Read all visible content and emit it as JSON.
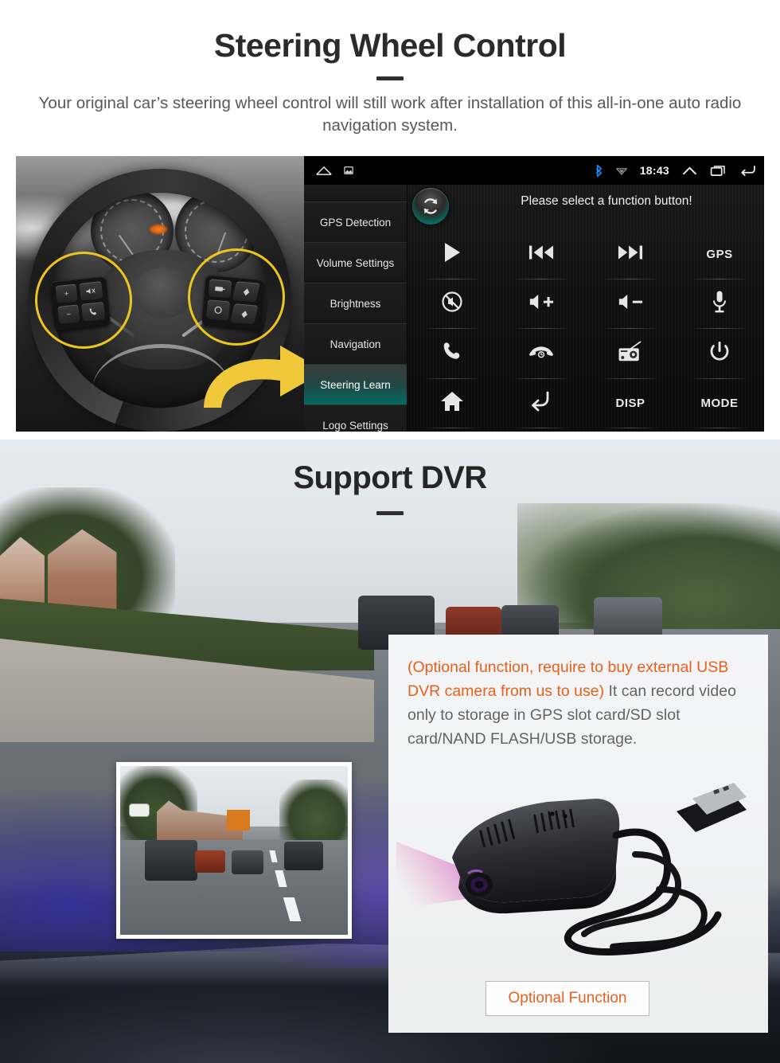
{
  "section1": {
    "title": "Steering Wheel Control",
    "subtitle": "Your original car’s steering wheel control will still work after installation of this all-in-one auto radio navigation system.",
    "statusbar": {
      "home_icon": "home-outline-icon",
      "screenshot_icon": "screenshot-icon",
      "bluetooth_icon": "bluetooth-icon",
      "wifi_icon": "wifi-icon",
      "clock": "18:43",
      "chevron_up_icon": "chevron-up-icon",
      "recents_icon": "recents-icon",
      "back_icon": "back-icon",
      "bluetooth_color": "#1a8cff"
    },
    "menu": {
      "items": [
        {
          "label": "GPS Detection",
          "active": false
        },
        {
          "label": "Volume Settings",
          "active": false
        },
        {
          "label": "Brightness",
          "active": false
        },
        {
          "label": "Navigation",
          "active": false
        },
        {
          "label": "Steering Learn",
          "active": true
        },
        {
          "label": "Logo Settings",
          "active": false
        }
      ],
      "active_color": "#046b63"
    },
    "panel": {
      "prompt": "Please select a function button!",
      "refresh_icon": "refresh-icon",
      "buttons": [
        {
          "icon": "play-icon",
          "label": ""
        },
        {
          "icon": "previous-icon",
          "label": ""
        },
        {
          "icon": "next-icon",
          "label": ""
        },
        {
          "icon": "gps-text-icon",
          "label": "GPS"
        },
        {
          "icon": "mute-ban-icon",
          "label": ""
        },
        {
          "icon": "volume-up-icon",
          "label": ""
        },
        {
          "icon": "volume-down-icon",
          "label": ""
        },
        {
          "icon": "microphone-icon",
          "label": ""
        },
        {
          "icon": "phone-call-icon",
          "label": ""
        },
        {
          "icon": "phone-hangup-icon",
          "label": ""
        },
        {
          "icon": "radio-icon",
          "label": ""
        },
        {
          "icon": "power-icon",
          "label": ""
        },
        {
          "icon": "home-icon",
          "label": ""
        },
        {
          "icon": "back-arrow-icon",
          "label": ""
        },
        {
          "icon": "disp-text-icon",
          "label": "DISP"
        },
        {
          "icon": "mode-text-icon",
          "label": "MODE"
        }
      ]
    },
    "photo": {
      "description": "steering-wheel-photo",
      "highlight_color": "#ecc61e",
      "arrow_icon": "curved-arrow-icon",
      "left_pad_keys": [
        "+",
        "−",
        "mute-speaker",
        "phone"
      ],
      "right_pad_keys": [
        "source",
        "up",
        "select",
        "down"
      ]
    }
  },
  "section2": {
    "title": "Support DVR",
    "info_orange": "(Optional function, require to buy external USB DVR camera from us to use)",
    "info_gray": "It can record video only to storage in GPS slot card/SD slot card/NAND FLASH/USB storage.",
    "button_label": "Optional Function",
    "orange_color": "#e8601c",
    "dashcam_thumbnail": "dashcam-video-thumbnail",
    "product_image": "usb-dvr-camera-photo"
  }
}
